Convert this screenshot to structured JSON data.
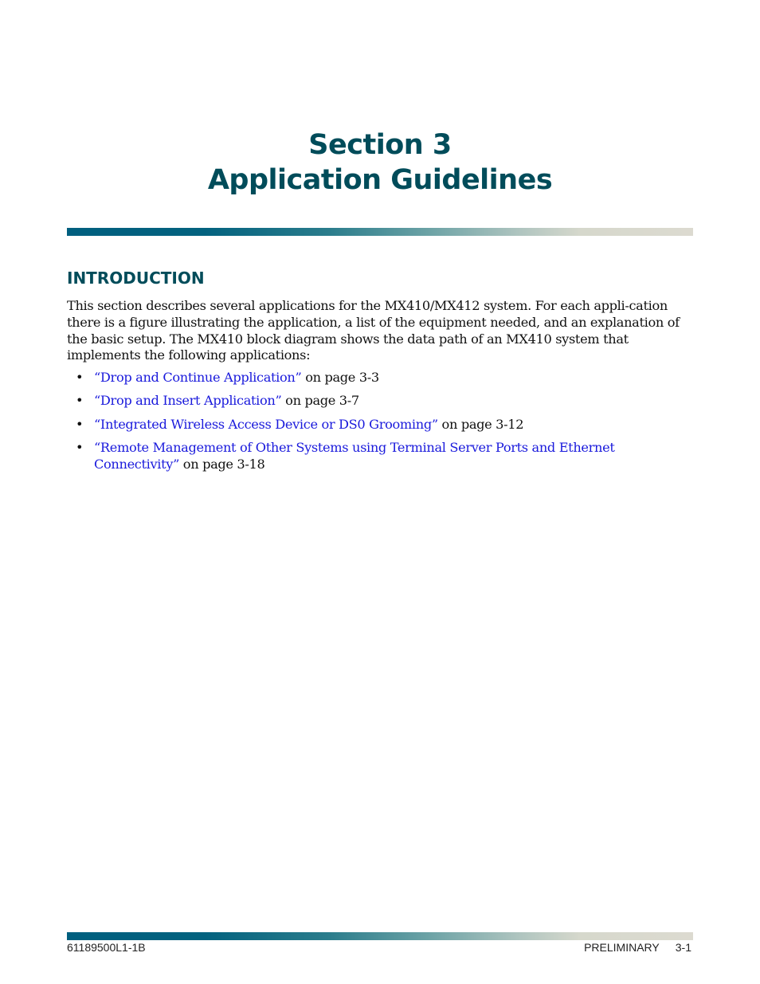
{
  "title": {
    "line1": "Section 3",
    "line2": "Application Guidelines"
  },
  "colors": {
    "heading": "#004c5a",
    "link": "#1a1adc",
    "rule_start": "#005f7f",
    "rule_end": "#dcdad0"
  },
  "introduction": {
    "heading": "INTRODUCTION",
    "paragraph": "This section describes several applications for the MX410/MX412 system. For each appli-cation there is a figure illustrating the application, a list of the equipment needed, and an explanation of the basic setup. The MX410 block diagram shows the data path of an MX410 system that implements the following applications:",
    "items": [
      {
        "link": "“Drop and Continue Application”",
        "suffix": " on page 3-3"
      },
      {
        "link": "“Drop and Insert Application”",
        "suffix": " on page 3-7"
      },
      {
        "link": "“Integrated Wireless Access Device or DS0 Grooming”",
        "suffix": " on page 3-12"
      },
      {
        "link": "“Remote Management of Other Systems using Terminal Server Ports and Ethernet Connectivity”",
        "suffix": " on page 3-18"
      }
    ],
    "bullet_glyph": "•"
  },
  "footer": {
    "doc_number": "61189500L1-1B",
    "status": "PRELIMINARY",
    "page": "3-1"
  }
}
